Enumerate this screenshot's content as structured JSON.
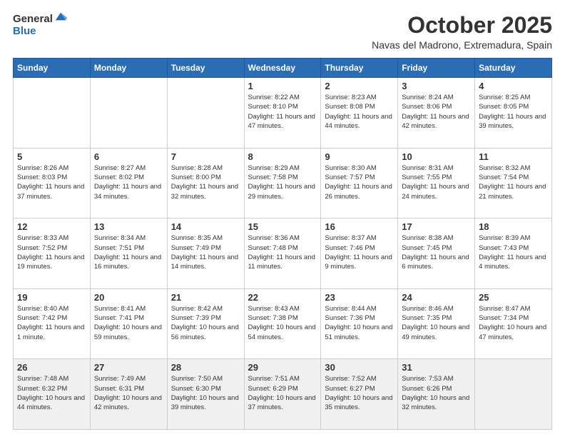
{
  "logo": {
    "general": "General",
    "blue": "Blue"
  },
  "header": {
    "month": "October 2025",
    "location": "Navas del Madrono, Extremadura, Spain"
  },
  "days_of_week": [
    "Sunday",
    "Monday",
    "Tuesday",
    "Wednesday",
    "Thursday",
    "Friday",
    "Saturday"
  ],
  "weeks": [
    [
      {
        "day": "",
        "info": ""
      },
      {
        "day": "",
        "info": ""
      },
      {
        "day": "",
        "info": ""
      },
      {
        "day": "1",
        "info": "Sunrise: 8:22 AM\nSunset: 8:10 PM\nDaylight: 11 hours and 47 minutes."
      },
      {
        "day": "2",
        "info": "Sunrise: 8:23 AM\nSunset: 8:08 PM\nDaylight: 11 hours and 44 minutes."
      },
      {
        "day": "3",
        "info": "Sunrise: 8:24 AM\nSunset: 8:06 PM\nDaylight: 11 hours and 42 minutes."
      },
      {
        "day": "4",
        "info": "Sunrise: 8:25 AM\nSunset: 8:05 PM\nDaylight: 11 hours and 39 minutes."
      }
    ],
    [
      {
        "day": "5",
        "info": "Sunrise: 8:26 AM\nSunset: 8:03 PM\nDaylight: 11 hours and 37 minutes."
      },
      {
        "day": "6",
        "info": "Sunrise: 8:27 AM\nSunset: 8:02 PM\nDaylight: 11 hours and 34 minutes."
      },
      {
        "day": "7",
        "info": "Sunrise: 8:28 AM\nSunset: 8:00 PM\nDaylight: 11 hours and 32 minutes."
      },
      {
        "day": "8",
        "info": "Sunrise: 8:29 AM\nSunset: 7:58 PM\nDaylight: 11 hours and 29 minutes."
      },
      {
        "day": "9",
        "info": "Sunrise: 8:30 AM\nSunset: 7:57 PM\nDaylight: 11 hours and 26 minutes."
      },
      {
        "day": "10",
        "info": "Sunrise: 8:31 AM\nSunset: 7:55 PM\nDaylight: 11 hours and 24 minutes."
      },
      {
        "day": "11",
        "info": "Sunrise: 8:32 AM\nSunset: 7:54 PM\nDaylight: 11 hours and 21 minutes."
      }
    ],
    [
      {
        "day": "12",
        "info": "Sunrise: 8:33 AM\nSunset: 7:52 PM\nDaylight: 11 hours and 19 minutes."
      },
      {
        "day": "13",
        "info": "Sunrise: 8:34 AM\nSunset: 7:51 PM\nDaylight: 11 hours and 16 minutes."
      },
      {
        "day": "14",
        "info": "Sunrise: 8:35 AM\nSunset: 7:49 PM\nDaylight: 11 hours and 14 minutes."
      },
      {
        "day": "15",
        "info": "Sunrise: 8:36 AM\nSunset: 7:48 PM\nDaylight: 11 hours and 11 minutes."
      },
      {
        "day": "16",
        "info": "Sunrise: 8:37 AM\nSunset: 7:46 PM\nDaylight: 11 hours and 9 minutes."
      },
      {
        "day": "17",
        "info": "Sunrise: 8:38 AM\nSunset: 7:45 PM\nDaylight: 11 hours and 6 minutes."
      },
      {
        "day": "18",
        "info": "Sunrise: 8:39 AM\nSunset: 7:43 PM\nDaylight: 11 hours and 4 minutes."
      }
    ],
    [
      {
        "day": "19",
        "info": "Sunrise: 8:40 AM\nSunset: 7:42 PM\nDaylight: 11 hours and 1 minute."
      },
      {
        "day": "20",
        "info": "Sunrise: 8:41 AM\nSunset: 7:41 PM\nDaylight: 10 hours and 59 minutes."
      },
      {
        "day": "21",
        "info": "Sunrise: 8:42 AM\nSunset: 7:39 PM\nDaylight: 10 hours and 56 minutes."
      },
      {
        "day": "22",
        "info": "Sunrise: 8:43 AM\nSunset: 7:38 PM\nDaylight: 10 hours and 54 minutes."
      },
      {
        "day": "23",
        "info": "Sunrise: 8:44 AM\nSunset: 7:36 PM\nDaylight: 10 hours and 51 minutes."
      },
      {
        "day": "24",
        "info": "Sunrise: 8:46 AM\nSunset: 7:35 PM\nDaylight: 10 hours and 49 minutes."
      },
      {
        "day": "25",
        "info": "Sunrise: 8:47 AM\nSunset: 7:34 PM\nDaylight: 10 hours and 47 minutes."
      }
    ],
    [
      {
        "day": "26",
        "info": "Sunrise: 7:48 AM\nSunset: 6:32 PM\nDaylight: 10 hours and 44 minutes."
      },
      {
        "day": "27",
        "info": "Sunrise: 7:49 AM\nSunset: 6:31 PM\nDaylight: 10 hours and 42 minutes."
      },
      {
        "day": "28",
        "info": "Sunrise: 7:50 AM\nSunset: 6:30 PM\nDaylight: 10 hours and 39 minutes."
      },
      {
        "day": "29",
        "info": "Sunrise: 7:51 AM\nSunset: 6:29 PM\nDaylight: 10 hours and 37 minutes."
      },
      {
        "day": "30",
        "info": "Sunrise: 7:52 AM\nSunset: 6:27 PM\nDaylight: 10 hours and 35 minutes."
      },
      {
        "day": "31",
        "info": "Sunrise: 7:53 AM\nSunset: 6:26 PM\nDaylight: 10 hours and 32 minutes."
      },
      {
        "day": "",
        "info": ""
      }
    ]
  ]
}
